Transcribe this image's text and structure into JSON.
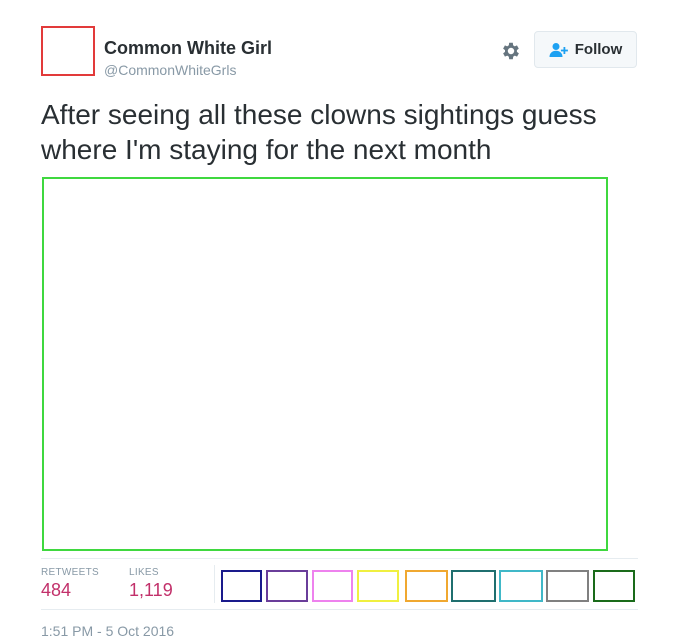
{
  "user": {
    "display_name": "Common White Girl",
    "screen_name": "@CommonWhiteGrls"
  },
  "header": {
    "settings_icon": "gear-icon",
    "follow_icon": "person-plus-icon",
    "follow_label": "Follow"
  },
  "tweet": {
    "text": "After seeing all these clowns sightings guess where I'm staying for the next month"
  },
  "stats": {
    "retweets_label": "RETWEETS",
    "retweets_value": "484",
    "likes_label": "LIKES",
    "likes_value": "1,119"
  },
  "likers": [
    {
      "color": "#1a1a8c"
    },
    {
      "color": "#6a3d9a"
    },
    {
      "color": "#ee82ee"
    },
    {
      "color": "#f0f040"
    },
    {
      "color": "#f0a830"
    },
    {
      "color": "#1f6f6f"
    },
    {
      "color": "#40b8c8"
    },
    {
      "color": "#808080"
    },
    {
      "color": "#1a6b1a"
    }
  ],
  "footer": {
    "timestamp": "1:51 PM - 5 Oct 2016"
  },
  "colors": {
    "avatar_border": "#e23a3a",
    "media_border": "#3fd83f",
    "stat_value": "#c2306a",
    "follow_icon": "#1da1f2"
  }
}
